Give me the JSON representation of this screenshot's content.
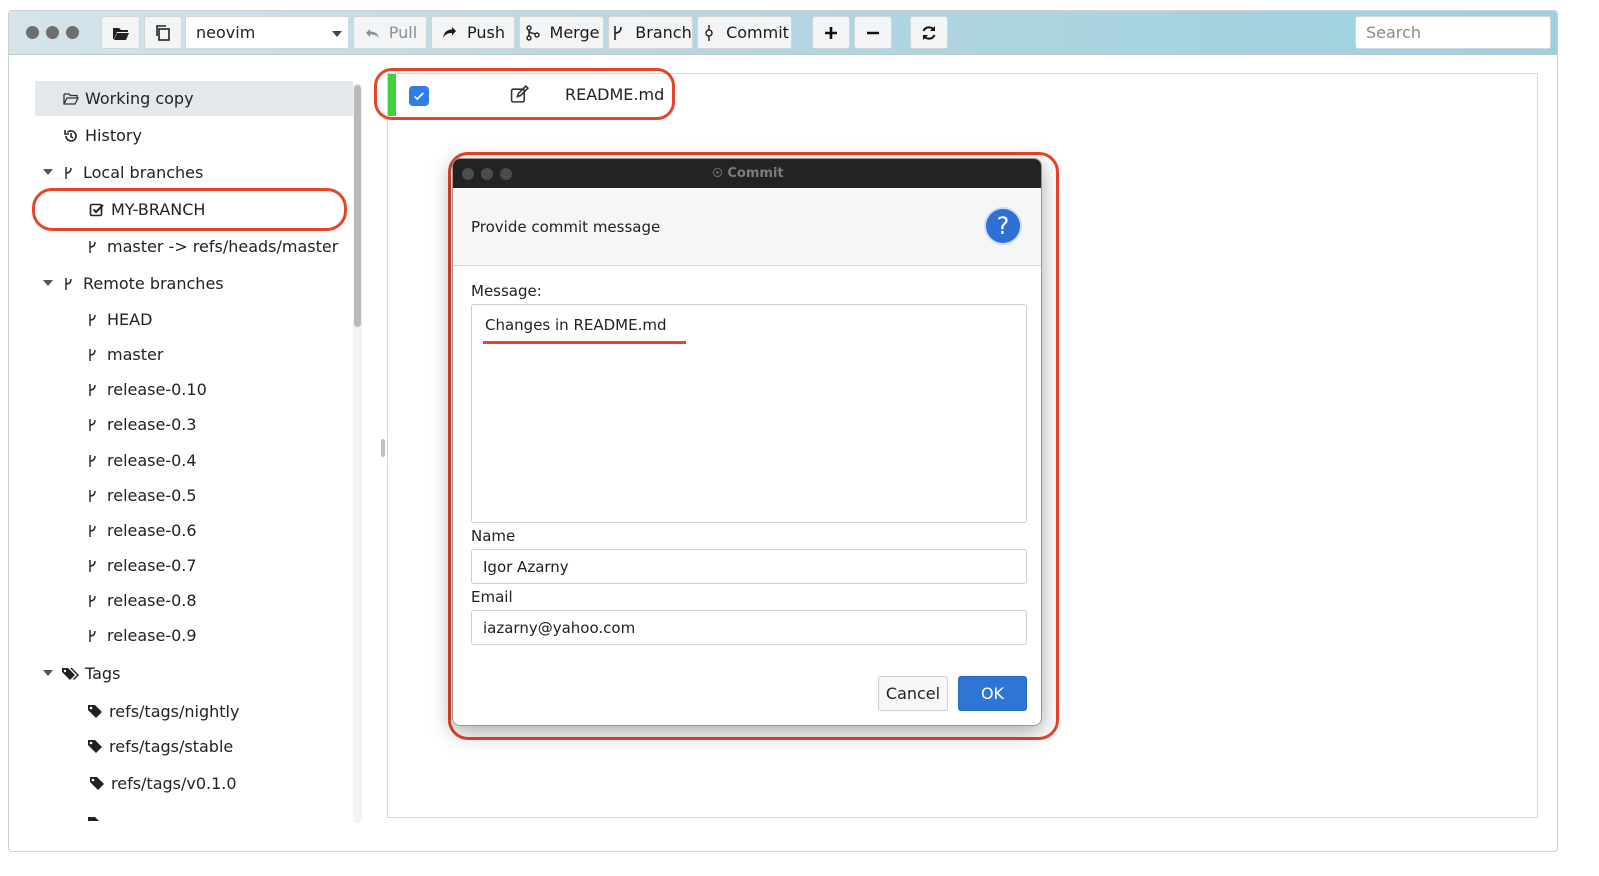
{
  "toolbar": {
    "repo_name": "neovim",
    "pull_label": "Pull",
    "push_label": "Push",
    "merge_label": "Merge",
    "branch_label": "Branch",
    "commit_label": "Commit",
    "search_placeholder": "Search"
  },
  "sidebar": {
    "working_copy": "Working copy",
    "history": "History",
    "local_branches_header": "Local branches",
    "local_branches": [
      "MY-BRANCH",
      "master -> refs/heads/master"
    ],
    "remote_branches_header": "Remote branches",
    "remote_branches": [
      "HEAD",
      "master",
      "release-0.10",
      "release-0.3",
      "release-0.4",
      "release-0.5",
      "release-0.6",
      "release-0.7",
      "release-0.8",
      "release-0.9"
    ],
    "tags_header": "Tags",
    "tags": [
      "refs/tags/nightly",
      "refs/tags/stable",
      "refs/tags/v0.1.0"
    ]
  },
  "file_list": {
    "files": [
      {
        "name": "README.md",
        "checked": true
      }
    ]
  },
  "commit_dialog": {
    "title": "Commit",
    "prompt": "Provide commit message",
    "help_symbol": "?",
    "message_label": "Message:",
    "message_value": "Changes in README.md",
    "name_label": "Name",
    "name_value": "Igor Azarny",
    "email_label": "Email",
    "email_value": "iazarny@yahoo.com",
    "cancel_label": "Cancel",
    "ok_label": "OK"
  },
  "colors": {
    "highlight": "#e8442a",
    "accent_blue": "#2f75d6",
    "file_status_green": "#3fd13f"
  }
}
